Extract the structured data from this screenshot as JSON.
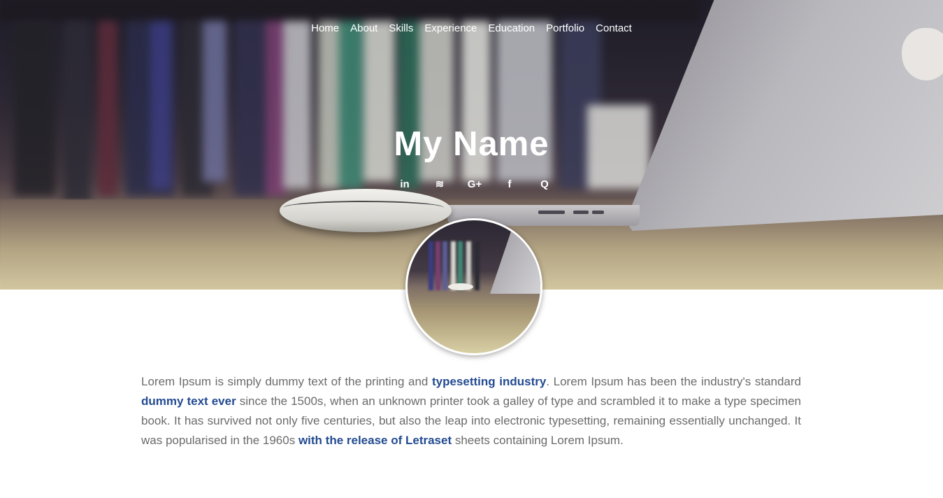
{
  "nav": {
    "items": [
      {
        "label": "Home"
      },
      {
        "label": "About"
      },
      {
        "label": "Skills"
      },
      {
        "label": "Experience"
      },
      {
        "label": "Education"
      },
      {
        "label": "Portfolio"
      },
      {
        "label": "Contact"
      }
    ]
  },
  "hero": {
    "title": "My Name"
  },
  "socials": {
    "linkedin": "in",
    "stackoverflow": "≋",
    "googleplus": "G+",
    "facebook": "f",
    "quora": "Q",
    "icons": [
      "linkedin-icon",
      "stackoverflow-icon",
      "google-plus-icon",
      "facebook-icon",
      "quora-icon"
    ]
  },
  "bio": {
    "part1": "Lorem Ipsum is simply dummy text of the printing and ",
    "link1": "typesetting industry",
    "part2": ". Lorem Ipsum has been the industry's standard ",
    "link2": "dummy text ever",
    "part3": " since the 1500s, when an unknown printer took a galley of type and scrambled it to make a type specimen book. It has survived not only five centuries, but also the leap into electronic typesetting, remaining essentially unchanged. It was popularised in the 1960s ",
    "link3": "with the release of Letraset",
    "part4": " sheets containing Lorem Ipsum."
  },
  "colors": {
    "link": "#234b91",
    "body_text": "#6b6b6b",
    "nav_text": "#ffffff"
  }
}
